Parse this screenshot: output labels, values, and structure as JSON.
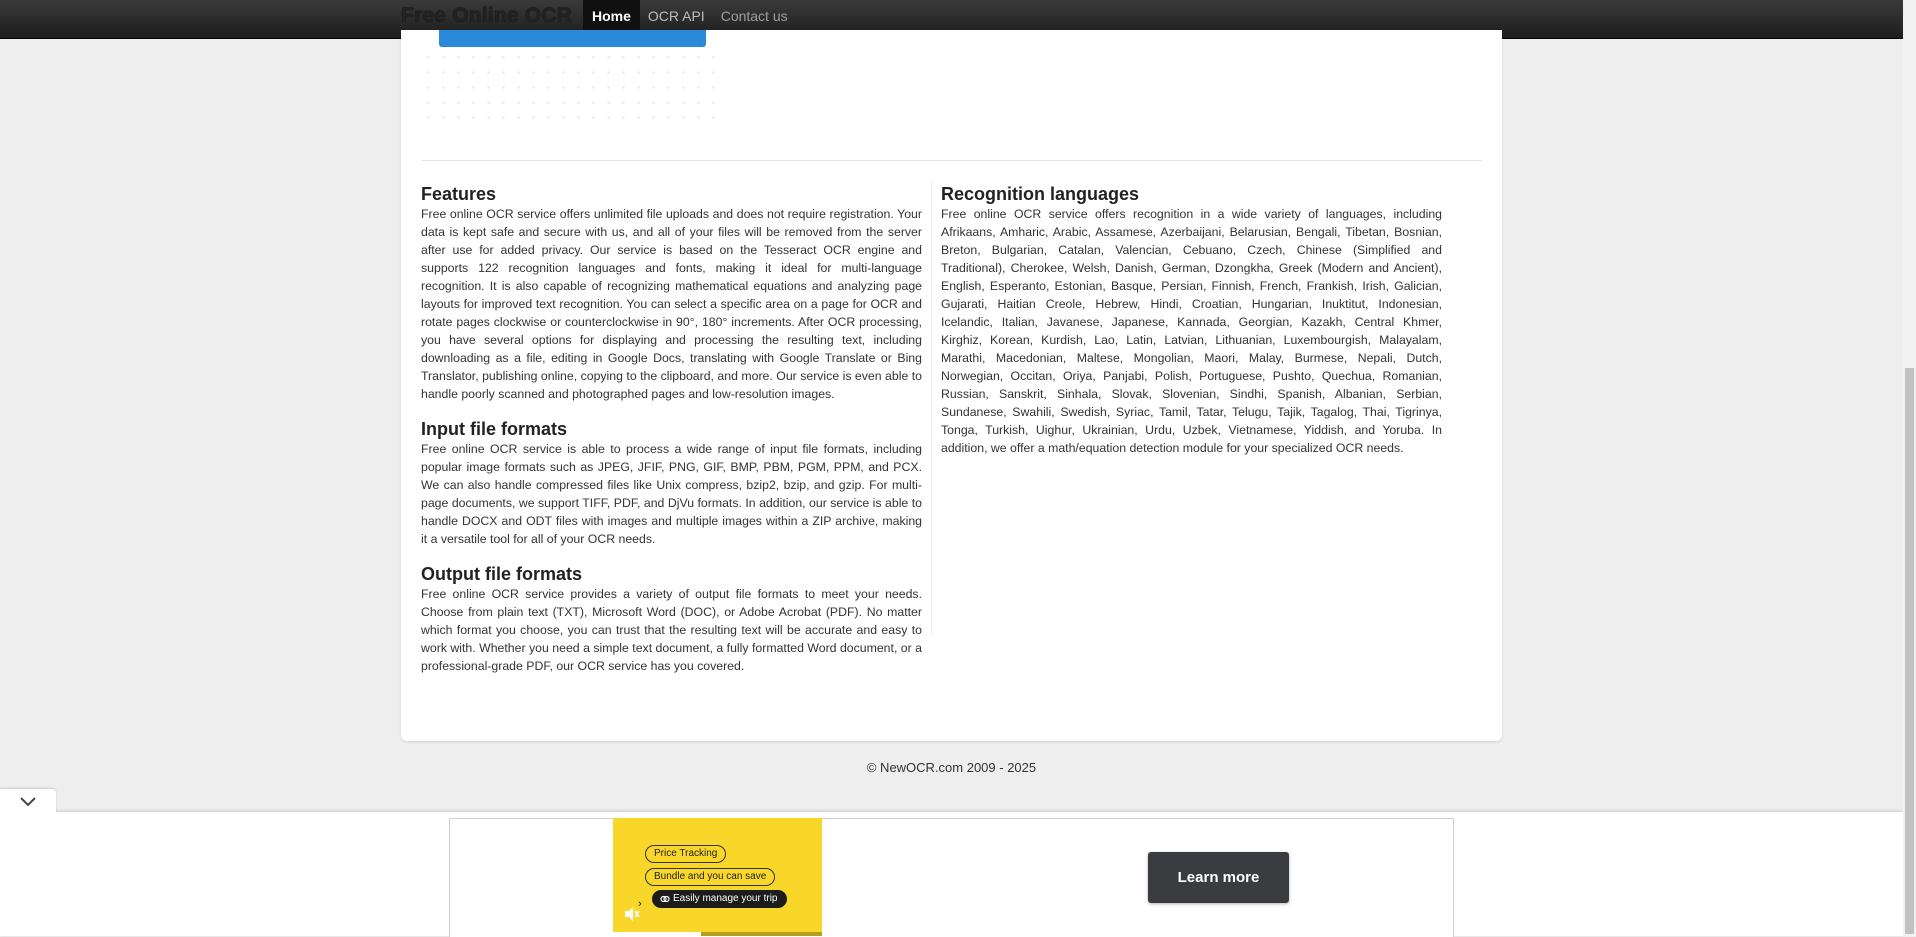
{
  "navbar": {
    "brand": "Free Online OCR",
    "items": [
      {
        "label": "Home"
      },
      {
        "label": "OCR API"
      },
      {
        "label": "Contact us"
      }
    ]
  },
  "features": {
    "title": "Features",
    "text": "Free online OCR service offers unlimited file uploads and does not require registration. Your data is kept safe and secure with us, and all of your files will be removed from the server after use for added privacy. Our service is based on the Tesseract OCR engine and supports 122 recognition languages and fonts, making it ideal for multi-language recognition. It is also capable of recognizing mathematical equations and analyzing page layouts for improved text recognition. You can select a specific area on a page for OCR and rotate pages clockwise or counterclockwise in 90°, 180° increments. After OCR processing, you have several options for displaying and processing the resulting text, including downloading as a file, editing in Google Docs, translating with Google Translate or Bing Translator, publishing online, copying to the clipboard, and more. Our service is even able to handle poorly scanned and photographed pages and low-resolution images."
  },
  "input_formats": {
    "title": "Input file formats",
    "text": "Free online OCR service is able to process a wide range of input file formats, including popular image formats such as JPEG, JFIF, PNG, GIF, BMP, PBM, PGM, PPM, and PCX. We can also handle compressed files like Unix compress, bzip2, bzip, and gzip. For multi-page documents, we support TIFF, PDF, and DjVu formats. In addition, our service is able to handle DOCX and ODT files with images and multiple images within a ZIP archive, making it a versatile tool for all of your OCR needs."
  },
  "output_formats": {
    "title": "Output file formats",
    "text": "Free online OCR service provides a variety of output file formats to meet your needs. Choose from plain text (TXT), Microsoft Word (DOC), or Adobe Acrobat (PDF). No matter which format you choose, you can trust that the resulting text will be accurate and easy to work with. Whether you need a simple text document, a fully formatted Word document, or a professional-grade PDF, our OCR service has you covered."
  },
  "languages": {
    "title": "Recognition languages",
    "text": "Free online OCR service offers recognition in a wide variety of languages, including Afrikaans, Amharic, Arabic, Assamese, Azerbaijani, Belarusian, Bengali, Tibetan, Bosnian, Breton, Bulgarian, Catalan, Valencian, Cebuano, Czech, Chinese (Simplified and Traditional), Cherokee, Welsh, Danish, German, Dzongkha, Greek (Modern and Ancient), English, Esperanto, Estonian, Basque, Persian, Finnish, French, Frankish, Irish, Galician, Gujarati, Haitian Creole, Hebrew, Hindi, Croatian, Hungarian, Inuktitut, Indonesian, Icelandic, Italian, Javanese, Japanese, Kannada, Georgian, Kazakh, Central Khmer, Kirghiz, Korean, Kurdish, Lao, Latin, Latvian, Lithuanian, Luxembourgish, Malayalam, Marathi, Macedonian, Maltese, Mongolian, Maori, Malay, Burmese, Nepali, Dutch, Norwegian, Occitan, Oriya, Panjabi, Polish, Portuguese, Pushto, Quechua, Romanian, Russian, Sanskrit, Sinhala, Slovak, Slovenian, Sindhi, Spanish, Albanian, Serbian, Sundanese, Swahili, Swedish, Syriac, Tamil, Tatar, Telugu, Tajik, Tagalog, Thai, Tigrinya, Tonga, Turkish, Uighur, Ukrainian, Urdu, Uzbek, Vietnamese, Yiddish, and Yoruba. In addition, we offer a math/equation detection module for your specialized OCR needs."
  },
  "footer": {
    "copyright": "© NewOCR.com 2009 - 2025"
  },
  "ad": {
    "pills": [
      "Price Tracking",
      "Bundle and you can save",
      "Easily manage your trip"
    ],
    "cta": "Learn more",
    "accent_color": "#f9d62a"
  },
  "colors": {
    "navbar": "#222222",
    "primary_button": "#2b8ad8",
    "page_background": "#eeeeee"
  }
}
